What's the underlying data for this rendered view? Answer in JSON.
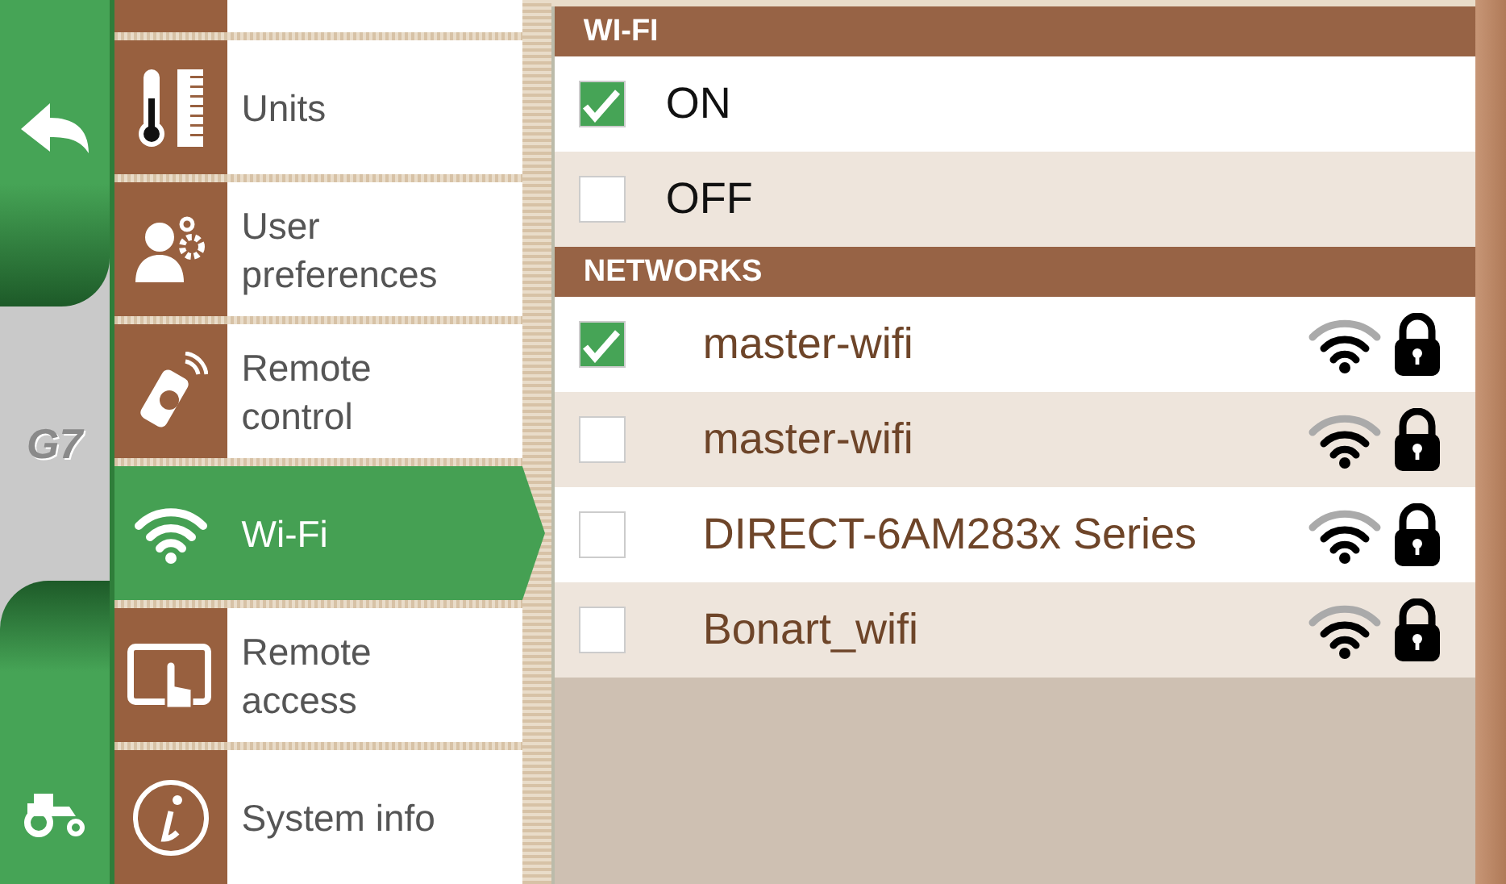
{
  "rail": {
    "logo": "G7"
  },
  "menu": [
    {
      "kind": "units",
      "label": "Units",
      "selected": false
    },
    {
      "kind": "user",
      "label": "User preferences",
      "selected": false
    },
    {
      "kind": "remote",
      "label": "Remote control",
      "selected": false
    },
    {
      "kind": "wifi",
      "label": "Wi-Fi",
      "selected": true
    },
    {
      "kind": "access",
      "label": "Remote access",
      "selected": false
    },
    {
      "kind": "info",
      "label": "System info",
      "selected": false
    }
  ],
  "wifi_section": {
    "title": "WI-FI",
    "options": [
      {
        "label": "ON",
        "checked": true
      },
      {
        "label": "OFF",
        "checked": false
      }
    ]
  },
  "networks_section": {
    "title": "NETWORKS",
    "networks": [
      {
        "name": "master-wifi",
        "checked": true
      },
      {
        "name": "master-wifi",
        "checked": false
      },
      {
        "name": "DIRECT-6AM283x Series",
        "checked": false
      },
      {
        "name": "Bonart_wifi",
        "checked": false
      }
    ]
  }
}
